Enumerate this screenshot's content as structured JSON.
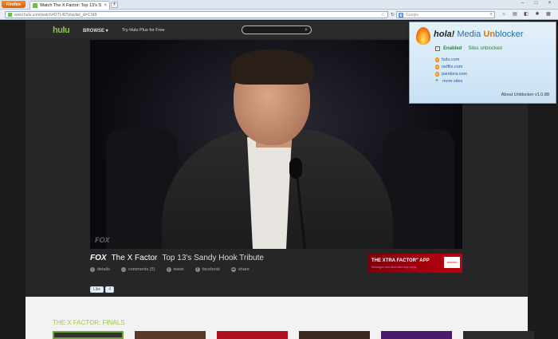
{
  "browser": {
    "menu_button": "Firefox",
    "tab_title": "Watch The X Factor: Top 13's Sandy Hoo...",
    "tab_close": "×",
    "new_tab": "+",
    "url": "www.hulu.com/watch/427140?playlist_id=1349",
    "search_placeholder": "Google",
    "window_controls": [
      "–",
      "□",
      "×"
    ]
  },
  "hulu": {
    "logo": "hulu",
    "browse": "BROWSE ▾",
    "try_plus": "Try Hulu Plus for Free",
    "network": "FOX",
    "show": "The X Factor",
    "episode": "Top 13's Sandy Hook Tribute",
    "actions": [
      {
        "label": "details",
        "icon": "info-icon"
      },
      {
        "label": "comments (5)",
        "icon": "comments-icon"
      },
      {
        "label": "tweet",
        "icon": "twitter-icon"
      },
      {
        "label": "facebook",
        "icon": "facebook-icon"
      },
      {
        "label": "share",
        "icon": "share-icon"
      }
    ],
    "fb_like": "Like",
    "fb_count": "4",
    "ad_title": "THE XTRA FACTOR\" APP",
    "ad_sub": "Messages and data rates may apply.",
    "ad_badge": "verizon",
    "video_bug": "FOX",
    "section_title": "THE X FACTOR: FINALS"
  },
  "hola": {
    "brand": "hola!",
    "title_media": "Media",
    "title_un": "Un",
    "title_blocker": "blocker",
    "enabled_label": "Enabled",
    "sites_unblocked": "Sites unblocked",
    "sites": [
      "hulu.com",
      "netflix.com",
      "pandora.com"
    ],
    "more_sites": "more sites",
    "about": "About Unblocker v1.0.88"
  }
}
